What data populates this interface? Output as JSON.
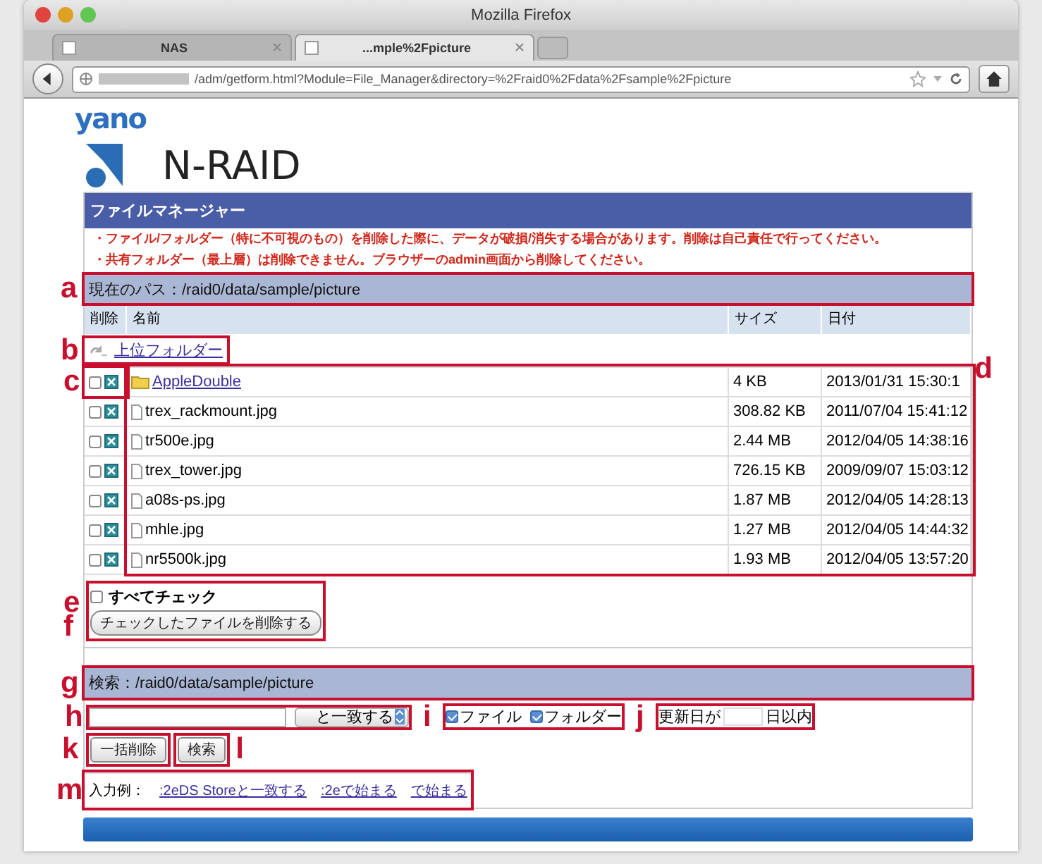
{
  "browser": {
    "title": "Mozilla Firefox",
    "tabs": [
      {
        "label": "NAS",
        "selected": false
      },
      {
        "label": "...mple%2Fpicture",
        "selected": true
      }
    ],
    "url": "/adm/getform.html?Module=File_Manager&directory=%2Fraid0%2Fdata%2Fsample%2Fpicture"
  },
  "logo": {
    "brand": "yano",
    "product": "N-RAID"
  },
  "file_manager": {
    "title": "ファイルマネージャー",
    "warnings": [
      "・ファイル/フォルダー（特に不可視のもの）を削除した際に、データが破損/消失する場合があります。削除は自己責任で行ってください。",
      "・共有フォルダー（最上層）は削除できません。ブラウザーのadmin画面から削除してください。"
    ],
    "path": {
      "callout": "a",
      "text": "現在のパス：/raid0/data/sample/picture"
    },
    "columns": [
      "削除",
      "名前",
      "サイズ",
      "日付"
    ],
    "parent_link": {
      "callout": "b",
      "label": "上位フォルダー"
    },
    "delete_callout": "c",
    "list_callout": "d",
    "rows": [
      {
        "kind": "folder",
        "name": "AppleDouble",
        "size": "4 KB",
        "date": "2013/01/31 15:30:1",
        "checked": false
      },
      {
        "kind": "file",
        "name": "trex_rackmount.jpg",
        "size": "308.82 KB",
        "date": "2011/07/04 15:41:12",
        "checked": false
      },
      {
        "kind": "file",
        "name": "tr500e.jpg",
        "size": "2.44 MB",
        "date": "2012/04/05 14:38:16",
        "checked": false
      },
      {
        "kind": "file",
        "name": "trex_tower.jpg",
        "size": "726.15 KB",
        "date": "2009/09/07 15:03:12",
        "checked": false
      },
      {
        "kind": "file",
        "name": "a08s-ps.jpg",
        "size": "1.87 MB",
        "date": "2012/04/05 14:28:13",
        "checked": false
      },
      {
        "kind": "file",
        "name": "mhle.jpg",
        "size": "1.27 MB",
        "date": "2012/04/05 14:44:32",
        "checked": false
      },
      {
        "kind": "file",
        "name": "nr5500k.jpg",
        "size": "1.93 MB",
        "date": "2012/04/05 13:57:20",
        "checked": false
      }
    ],
    "check_all": {
      "callout": "e",
      "label": "すべてチェック",
      "checked": false
    },
    "delete_button": {
      "callout": "f",
      "label": "チェックしたファイルを削除する"
    }
  },
  "search": {
    "path": {
      "callout": "g",
      "text": "検索：/raid0/data/sample/picture"
    },
    "query": {
      "callout": "h",
      "match": "と一致する"
    },
    "types": {
      "callout": "i",
      "options": [
        {
          "label": "ファイル",
          "checked": true
        },
        {
          "label": "フォルダー",
          "checked": true
        }
      ]
    },
    "date": {
      "callout": "j",
      "prefix": "更新日が",
      "suffix": "日以内"
    },
    "clear_button": {
      "callout": "k",
      "label": "一括削除"
    },
    "search_button": {
      "callout": "l",
      "label": "検索"
    },
    "examples": {
      "callout": "m",
      "label": "入力例：",
      "links": [
        ":2eDS Storeと一致する",
        ":2eで始まる",
        "で始まる"
      ]
    }
  }
}
